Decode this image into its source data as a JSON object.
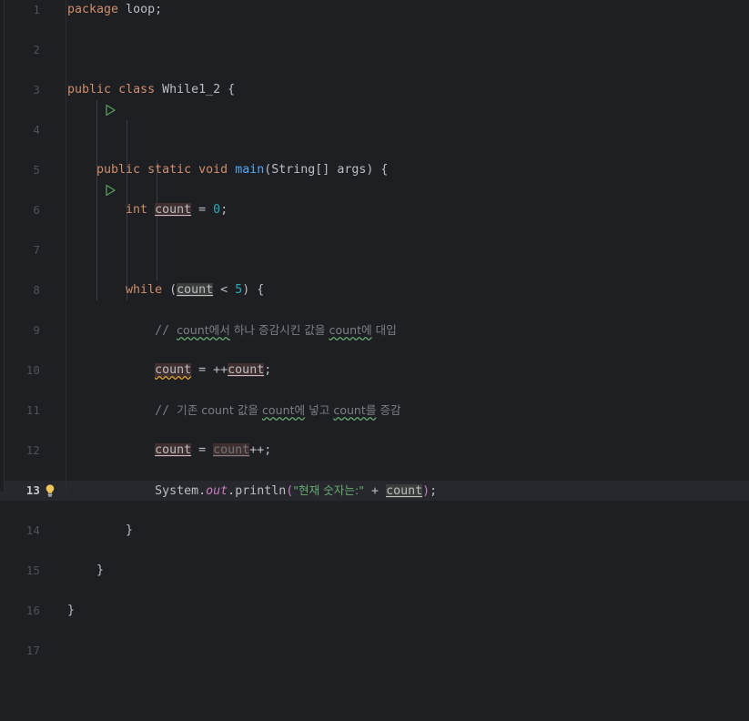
{
  "editor": {
    "background": "#1E1F22",
    "current_line_background": "#26282E",
    "gutter_divider_color": "#2B2D30",
    "current_line_number": 13,
    "total_visible_lines": 17,
    "font_size_px": 13,
    "line_height_px": 22
  },
  "colors": {
    "keyword": "#CF8E6D",
    "identifier": "#BCBEC4",
    "method": "#56A8F5",
    "number": "#2AACB8",
    "string": "#6AAB73",
    "comment": "#7A7E85",
    "static_field_italic": "#C77DBB",
    "matched_bracket": "#C77DBB",
    "write_access_highlight": "#3F2F2F",
    "read_access_highlight": "#3A3F3A",
    "warning_squiggle": "#E0A336",
    "typo_squiggle": "#6AAB73",
    "run_arrow": "#599E5E",
    "bulb": "#F2C55C",
    "line_number": "#4E5157",
    "current_line_number_text": "#C6C8CC",
    "indent_guide": "#393B40"
  },
  "gutter": {
    "line_numbers": [
      "1",
      "2",
      "3",
      "4",
      "5",
      "6",
      "7",
      "8",
      "9",
      "10",
      "11",
      "12",
      "13",
      "14",
      "15",
      "16",
      "17"
    ],
    "icons": [
      {
        "line": 3,
        "name": "run-gutter-icon",
        "label": "Run"
      },
      {
        "line": 5,
        "name": "run-gutter-icon",
        "label": "Run"
      },
      {
        "line": 13,
        "name": "intention-bulb-icon",
        "label": "Show context actions"
      }
    ]
  },
  "code": {
    "lines": [
      {
        "n": 1,
        "text": "package loop;"
      },
      {
        "n": 2,
        "text": ""
      },
      {
        "n": 3,
        "text": "public class While1_2 {"
      },
      {
        "n": 4,
        "text": ""
      },
      {
        "n": 5,
        "text": "    public static void main(String[] args) {"
      },
      {
        "n": 6,
        "text": "        int count = 0;"
      },
      {
        "n": 7,
        "text": ""
      },
      {
        "n": 8,
        "text": "        while (count < 5) {"
      },
      {
        "n": 9,
        "text": "            // count에서 하나 증감시킨 값을 count에 대입"
      },
      {
        "n": 10,
        "text": "            count = ++count;"
      },
      {
        "n": 11,
        "text": "            // 기존 count 값을 count에 넣고 count를 증감"
      },
      {
        "n": 12,
        "text": "            count = count++;"
      },
      {
        "n": 13,
        "text": "            System.out.println(\"현재 숫자는:\" + count);"
      },
      {
        "n": 14,
        "text": "        }"
      },
      {
        "n": 15,
        "text": "    }"
      },
      {
        "n": 16,
        "text": "}"
      },
      {
        "n": 17,
        "text": ""
      }
    ],
    "tokens": {
      "kw_package": "package",
      "name_loop": "loop",
      "kw_public": "public",
      "kw_class": "class",
      "name_class": "While1_2",
      "kw_static": "static",
      "kw_void": "void",
      "name_main": "main",
      "type_String": "String[]",
      "name_args": "args",
      "kw_int": "int",
      "var_count": "count",
      "num_zero": "0",
      "kw_while": "while",
      "op_lt": "<",
      "num_five": "5",
      "comment_9": "// count에서 하나 증감시킨 값을 count에 대입",
      "comment_9_a": "// ",
      "comment_9_count1": "count에서",
      "comment_9_mid": " 하나 증감시킨 값을 ",
      "comment_9_count2": "count에",
      "comment_9_end": " 대입",
      "comment_11_a": "// ",
      "comment_11_b": "기존 count 값을 ",
      "comment_11_count1": "count에",
      "comment_11_mid": " 넣고 ",
      "comment_11_count2": "count를",
      "comment_11_end": " 증감",
      "op_preinc": "++",
      "op_postinc": "++",
      "name_System": "System",
      "name_out": "out",
      "name_println": "println",
      "string_literal": "\"현재 숫자는:\"",
      "op_plus": "+",
      "semicolon": ";",
      "paren_open": "(",
      "paren_close": ")",
      "brace_open": "{",
      "brace_close": "}",
      "op_assign": "="
    }
  }
}
